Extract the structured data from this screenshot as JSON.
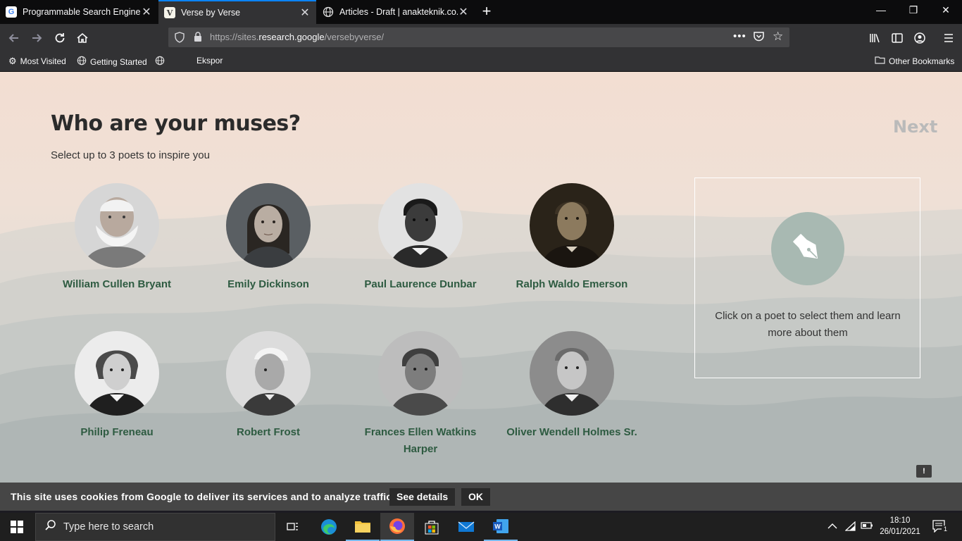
{
  "browser": {
    "tabs": [
      {
        "title": "Programmable Search Engine",
        "favicon": "G",
        "active": false
      },
      {
        "title": "Verse by Verse",
        "favicon": "V",
        "active": true
      },
      {
        "title": "Articles - Draft | anakteknik.co.id",
        "favicon": "globe",
        "active": false
      }
    ],
    "url_prefix": "https://sites.",
    "url_domain": "research.google",
    "url_path": "/versebyverse/",
    "bookmarks": {
      "most_visited": "Most Visited",
      "getting_started": "Getting Started",
      "ekspor": "Ekspor",
      "other": "Other Bookmarks"
    }
  },
  "page": {
    "heading": "Who are your muses?",
    "subheading": "Select up to 3 poets to inspire you",
    "next_label": "Next",
    "poets": [
      {
        "name": "William Cullen Bryant"
      },
      {
        "name": "Emily Dickinson"
      },
      {
        "name": "Paul Laurence Dunbar"
      },
      {
        "name": "Ralph Waldo Emerson"
      },
      {
        "name": "Philip Freneau"
      },
      {
        "name": "Robert Frost"
      },
      {
        "name": "Frances Ellen Watkins Harper"
      },
      {
        "name": "Oliver Wendell Holmes Sr."
      }
    ],
    "info_message": "Click on a poet to select them and learn more about them",
    "feedback_icon": "!",
    "cookie": {
      "text": "This site uses cookies from Google to deliver its services and to analyze traffic.",
      "details_label": "See details",
      "ok_label": "OK"
    }
  },
  "taskbar": {
    "search_placeholder": "Type here to search",
    "time": "18:10",
    "date": "26/01/2021",
    "notification_count": "1"
  },
  "colors": {
    "accent": "#0a84ff",
    "poet_name": "#2e5b41",
    "pen_circle": "#a8b9b2"
  }
}
